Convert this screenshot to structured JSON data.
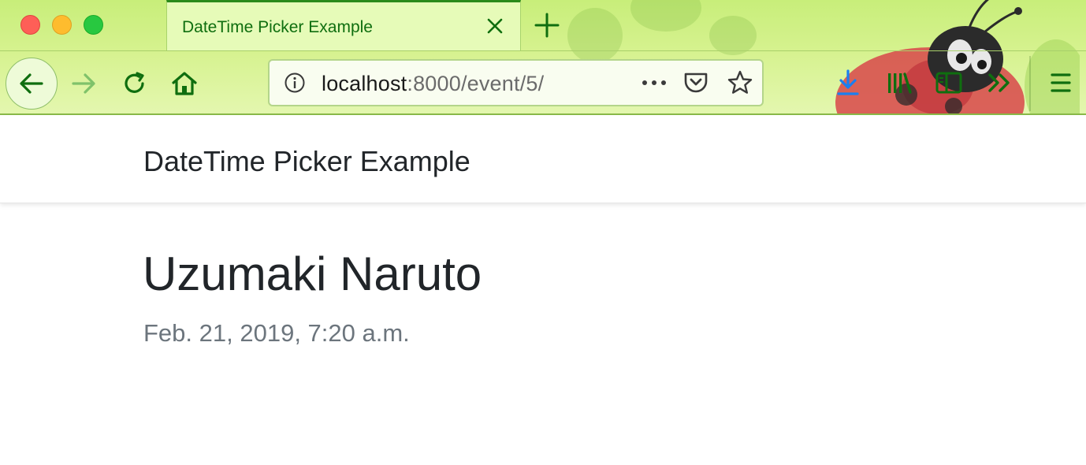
{
  "browser": {
    "tab": {
      "title": "DateTime Picker Example"
    },
    "url": {
      "host": "localhost",
      "path": ":8000/event/5/"
    },
    "colors": {
      "icon_green": "#0f6e0f",
      "download_blue": "#1a7ff0",
      "forward_disabled": "#7fc26a"
    },
    "icons": [
      "back-icon",
      "forward-icon",
      "reload-icon",
      "home-icon",
      "info-icon",
      "more-icon",
      "pocket-icon",
      "star-icon",
      "download-icon",
      "library-icon",
      "sidebar-icon",
      "overflow-icon",
      "menu-icon",
      "close-icon",
      "plus-icon"
    ]
  },
  "page": {
    "brand": "DateTime Picker Example",
    "event": {
      "title": "Uzumaki Naruto",
      "datetime": "Feb. 21, 2019, 7:20 a.m."
    }
  }
}
